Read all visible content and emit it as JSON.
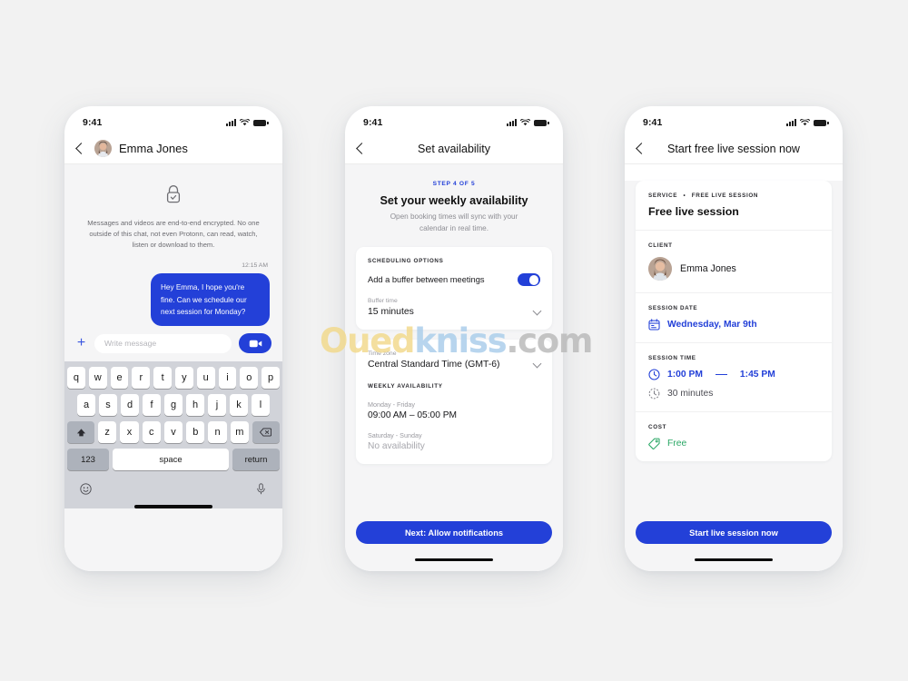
{
  "watermark": {
    "part1": "Oued",
    "part2": "kniss",
    "part3": ".com"
  },
  "colors": {
    "accent_blue": "#2340d8",
    "green": "#2aa765",
    "bg": "#f2f2f2",
    "screen_bg": "#f5f5f6"
  },
  "status_bar": {
    "time": "9:41",
    "signal_icon": "cellular-bars-icon",
    "wifi_icon": "wifi-icon",
    "battery_icon": "battery-full-icon"
  },
  "phone1": {
    "nav": {
      "back_icon": "chevron-left-icon",
      "avatar": "contact-avatar",
      "title": "Emma Jones"
    },
    "encryption": {
      "lock_icon": "lock-check-icon",
      "text": "Messages and videos are end-to-end encrypted. No one outside of this chat, not even Protonn, can read, watch, listen or download to them."
    },
    "message": {
      "time": "12:15 AM",
      "text": "Hey Emma, I hope you're fine. Can we schedule our next session for Monday?"
    },
    "composer": {
      "add_icon": "plus-icon",
      "placeholder": "Write message",
      "video_icon": "video-camera-icon"
    },
    "keyboard": {
      "row1": [
        "q",
        "w",
        "e",
        "r",
        "t",
        "y",
        "u",
        "i",
        "o",
        "p"
      ],
      "row2": [
        "a",
        "s",
        "d",
        "f",
        "g",
        "h",
        "j",
        "k",
        "l"
      ],
      "row3_letters": [
        "z",
        "x",
        "c",
        "v",
        "b",
        "n",
        "m"
      ],
      "shift_icon": "shift-arrow-icon",
      "backspace_icon": "backspace-icon",
      "numbers_key": "123",
      "space_key": "space",
      "return_key": "return",
      "emoji_icon": "emoji-smiley-icon",
      "mic_icon": "microphone-icon"
    }
  },
  "phone2": {
    "nav": {
      "back_icon": "chevron-left-icon",
      "title": "Set availability"
    },
    "step": {
      "tag": "STEP 4 OF 5",
      "title": "Set your weekly availability",
      "subtitle": "Open booking times will sync with your calendar in real time."
    },
    "scheduling": {
      "section_label": "SCHEDULING OPTIONS",
      "buffer_toggle_label": "Add a buffer between meetings",
      "buffer_toggle_state": "on",
      "buffer_time_label": "Buffer time",
      "buffer_time_value": "15 minutes",
      "dropdown_icon": "chevron-down-icon"
    },
    "timezone": {
      "label": "Time zone",
      "value": "Central Standard Time (GMT-6)",
      "dropdown_icon": "chevron-down-icon"
    },
    "weekly": {
      "section_label": "WEEKLY AVAILABILITY",
      "rows": [
        {
          "days": "Monday - Friday",
          "hours": "09:00 AM – 05:00 PM",
          "dim": false
        },
        {
          "days": "Saturday - Sunday",
          "hours": "No availability",
          "dim": true
        }
      ]
    },
    "cta": "Next: Allow notifications"
  },
  "phone3": {
    "nav": {
      "back_icon": "chevron-left-icon",
      "title": "Start free live session now"
    },
    "service": {
      "label_a": "SERVICE",
      "separator": "•",
      "label_b": "FREE LIVE SESSION",
      "title": "Free live session"
    },
    "client": {
      "label": "CLIENT",
      "avatar": "contact-avatar",
      "name": "Emma Jones"
    },
    "session_date": {
      "label": "SESSION DATE",
      "icon": "calendar-icon",
      "value": "Wednesday, Mar 9th"
    },
    "session_time": {
      "label": "SESSION TIME",
      "clock_icon": "clock-icon",
      "start": "1:00 PM",
      "end": "1:45 PM",
      "duration_icon": "clock-dashed-icon",
      "duration": "30 minutes"
    },
    "cost": {
      "label": "COST",
      "icon": "tag-icon",
      "value": "Free"
    },
    "cta": "Start live session now"
  }
}
